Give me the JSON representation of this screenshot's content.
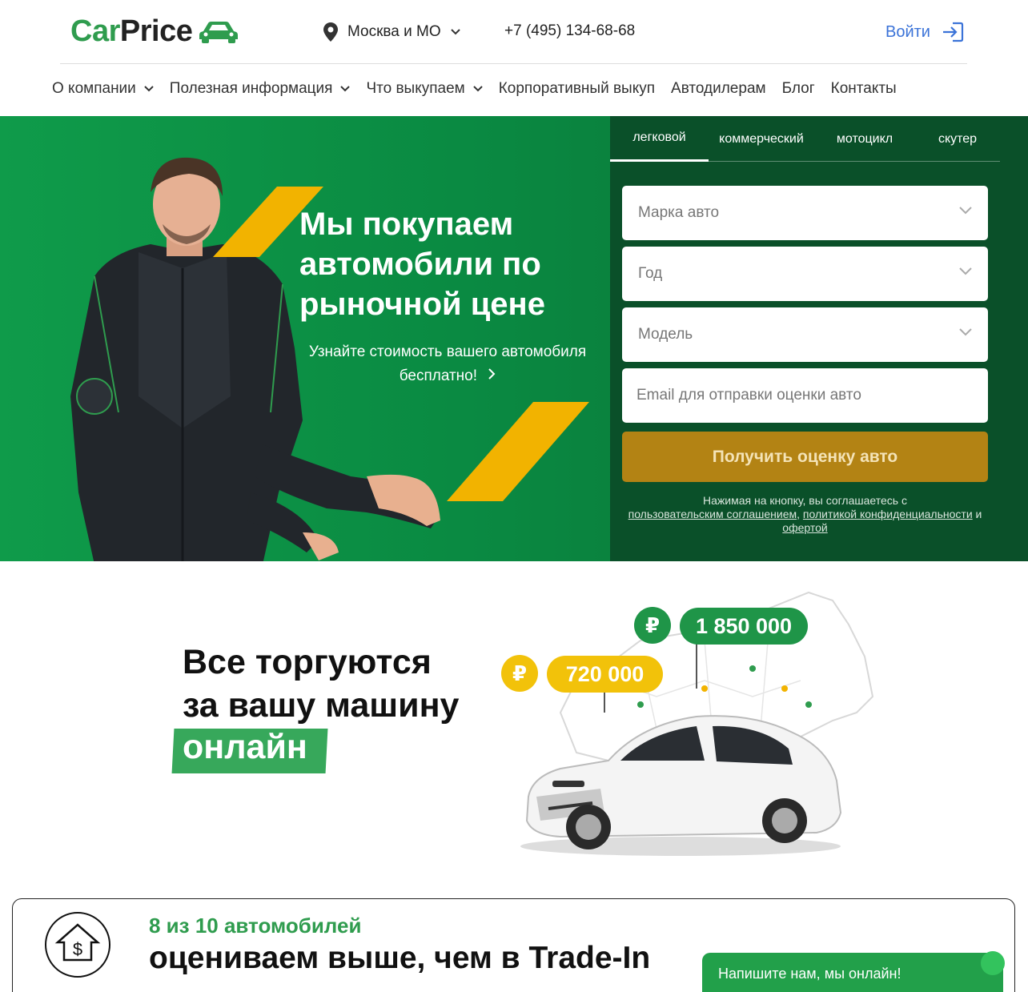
{
  "header": {
    "logo": {
      "part1": "Car",
      "part2": "Price",
      "icon": "car-icon"
    },
    "region": "Москва и МО",
    "phone": "+7 (495) 134-68-68",
    "login": "Войти"
  },
  "nav": [
    {
      "label": "О компании",
      "dropdown": true
    },
    {
      "label": "Полезная информация",
      "dropdown": true
    },
    {
      "label": "Что выкупаем",
      "dropdown": true
    },
    {
      "label": "Корпоративный выкуп",
      "dropdown": false
    },
    {
      "label": "Автодилерам",
      "dropdown": false
    },
    {
      "label": "Блог",
      "dropdown": false
    },
    {
      "label": "Контакты",
      "dropdown": false
    }
  ],
  "hero": {
    "title": "Мы покупаем автомобили по рыночной цене",
    "subtitle": "Узнайте стоимость вашего автомобиля бесплатно!",
    "colors": {
      "accent_green": "#0f9b4a",
      "stripe_yellow": "#f2b300",
      "panel": "#0a5029"
    }
  },
  "form": {
    "tabs": [
      {
        "label": "легковой",
        "active": true
      },
      {
        "label": "коммерческий",
        "active": false
      },
      {
        "label": "мотоцикл",
        "active": false
      },
      {
        "label": "скутер",
        "active": false
      }
    ],
    "make_placeholder": "Марка авто",
    "year_placeholder": "Год",
    "model_placeholder": "Модель",
    "email_placeholder": "Email для отправки оценки авто",
    "submit": "Получить оценку авто",
    "agree_prefix": "Нажимая на кнопку, вы соглашаетесь с",
    "agree_link1": "пользовательским соглашением",
    "agree_sep": ",",
    "agree_link2": "политикой конфиденциальности",
    "agree_and": "и",
    "agree_link3": "офертой"
  },
  "auction": {
    "line1": "Все торгуются",
    "line2": "за вашу машину",
    "highlight": "онлайн",
    "price_high": "1 850 000",
    "price_low": "720 000",
    "currency": "₽"
  },
  "card": {
    "green": "8 из 10 автомобилей",
    "big": "оцениваем выше, чем в Trade-In"
  },
  "chat": {
    "label": "Напишите нам, мы онлайн!"
  }
}
